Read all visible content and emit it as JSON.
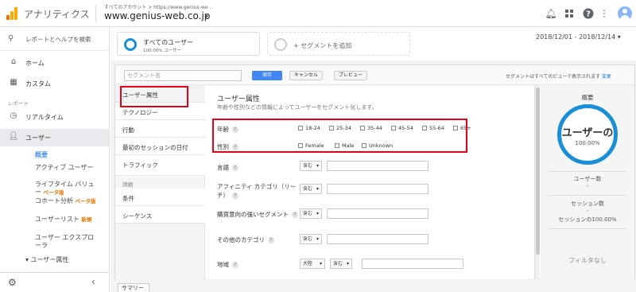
{
  "topbar": {
    "app_title": "アナリティクス",
    "account_crumb": "すべてのアカウント > https://www.genius-we...",
    "property": "www.genius-web.co.jp",
    "icons": [
      "bell-icon",
      "apps-icon",
      "help-icon",
      "more-icon",
      "avatar"
    ]
  },
  "leftnav": {
    "search": "レポートとヘルプを検索",
    "home": "ホーム",
    "custom": "カスタム",
    "section_reports": "レポート",
    "realtime": "リアルタイム",
    "audience": "ユーザー",
    "sub_items": [
      {
        "label": "概要",
        "badge": ""
      },
      {
        "label": "アクティブ ユーザー",
        "badge": ""
      },
      {
        "label": "ライフタイム バリュー",
        "badge": "ベータ版"
      },
      {
        "label": "コホート分析",
        "badge": "ベータ版"
      },
      {
        "label": "ユーザーリスト",
        "badge": "新規"
      },
      {
        "label": "ユーザー エクスプローラ",
        "badge": ""
      },
      {
        "label": "▾ ユーザー属性",
        "badge": ""
      }
    ]
  },
  "segments": {
    "all_users": "すべてのユーザー",
    "all_users_sub": "100.00% ユーザー",
    "add_segment": "+ セグメントを追加",
    "date_range": "2018/12/01 - 2018/12/14"
  },
  "editor": {
    "name_placeholder": "セグメント名",
    "save": "保存",
    "cancel": "キャンセル",
    "preview": "プレビュー",
    "visibility_note": "セグメントはすべてのビューで表示されます",
    "visibility_link": "変更"
  },
  "categories": {
    "items": [
      "ユーザー属性",
      "テクノロジー",
      "行動",
      "最初のセッションの日付",
      "トラフィック"
    ],
    "advanced_heading": "詳細",
    "advanced_items": [
      "条件",
      "シーケンス"
    ]
  },
  "form": {
    "title": "ユーザー属性",
    "description": "年齢や性別などの情報によってユーザーをセグメント化します。",
    "age_label": "年齢",
    "age_options": [
      "18-24",
      "25-34",
      "35-44",
      "45-54",
      "55-64",
      "65+"
    ],
    "gender_label": "性別",
    "gender_options": [
      "Female",
      "Male",
      "Unknown"
    ],
    "language_label": "言語",
    "affinity_label": "アフィニティ カテゴリ（リーチ）",
    "inmarket_label": "購買意向の強いセグメント",
    "other_label": "その他のカテゴリ",
    "location_label": "地域",
    "contains": "含む",
    "continent": "大陸"
  },
  "summary": {
    "title": "概要",
    "donut_label": "ユーザーの",
    "donut_pct": "100.00%",
    "users_label": "ユーザー数",
    "users_value": "-",
    "sessions_label": "セッション数",
    "sessions_value": "-",
    "sessions_pct": "セッションの100.00%",
    "filter_none": "フィルタなし"
  },
  "bottom_tab": "サマリー",
  "colors": {
    "accent_blue": "#4285f4",
    "donut": "#1a8fd8",
    "highlight_red": "#e4001b",
    "badge_orange": "#e37400"
  }
}
